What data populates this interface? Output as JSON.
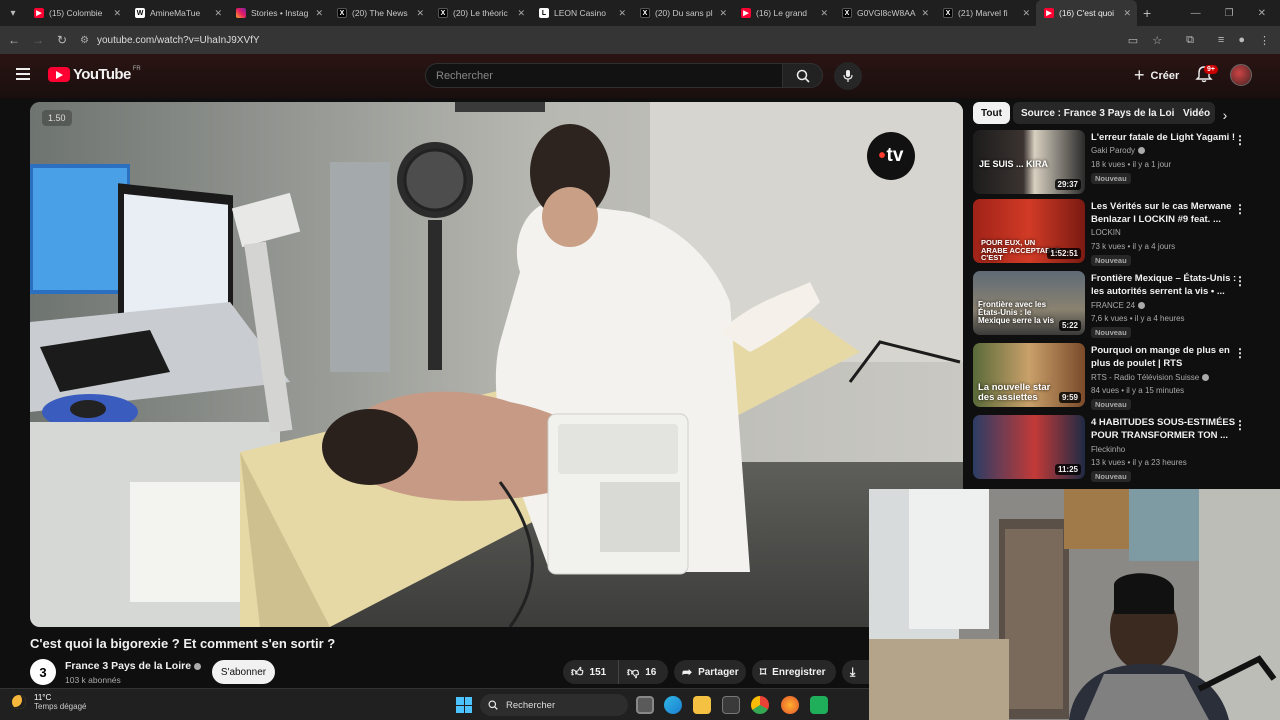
{
  "browser": {
    "tabs": [
      {
        "label": "(15) Colombie",
        "icon": "youtube-icon"
      },
      {
        "label": "AmineMaTue",
        "icon": "w-icon"
      },
      {
        "label": "Stories • Instag",
        "icon": "instagram-icon"
      },
      {
        "label": "(20) The News",
        "icon": "x-icon"
      },
      {
        "label": "(20) Le théoric",
        "icon": "x-icon"
      },
      {
        "label": "LEON Casino",
        "icon": "leon-icon"
      },
      {
        "label": "(20) Du sans pl",
        "icon": "x-icon"
      },
      {
        "label": "(16) Le grand",
        "icon": "youtube-icon"
      },
      {
        "label": "G0VGl8cW8AA",
        "icon": "x-icon"
      },
      {
        "label": "(21) Marvel fi",
        "icon": "x-icon"
      },
      {
        "label": "(16) C'est quoi",
        "icon": "youtube-icon",
        "active": true
      }
    ],
    "url": "youtube.com/watch?v=UhaInJ9XVfY"
  },
  "header": {
    "logo_text": "YouTube",
    "country": "FR",
    "search_placeholder": "Rechercher",
    "create_label": "Créer",
    "notif_count": "9+"
  },
  "video": {
    "speed_badge": "1.50",
    "channel_watermark": "tv",
    "title": "C'est quoi la bigorexie ? Et comment s'en sortir ?",
    "channel": "France 3 Pays de la Loire",
    "channel_avatar_text": "3",
    "subscribers": "103 k abonnés",
    "subscribe_label": "S'abonner",
    "likes": "151",
    "dislikes": "16",
    "share_label": "Partager",
    "save_label": "Enregistrer"
  },
  "sidebar": {
    "chips": [
      "Tout",
      "Source : France 3 Pays de la Loire",
      "Vidéo"
    ],
    "recommendations": [
      {
        "title": "L'erreur fatale de Light Yagami !",
        "channel": "Gaki Parody",
        "verified": true,
        "meta": "18 k vues • il y a 1 jour",
        "duration": "29:37",
        "badge": "Nouveau",
        "thumb_text": "JE SUIS ... KIRA"
      },
      {
        "title": "Les Vérités sur le cas Merwane Benlazar I LOCKIN #9 feat. ...",
        "channel": "LOCKIN",
        "verified": false,
        "meta": "73 k vues • il y a 4 jours",
        "duration": "1:52:51",
        "badge": "Nouveau",
        "thumb_text": "POUR EUX, UN ARABE ACCEPTABLE C'EST"
      },
      {
        "title": "Frontière Mexique – États-Unis : les autorités serrent la vis • ...",
        "channel": "FRANCE 24",
        "verified": true,
        "meta": "7,6 k vues • il y a 4 heures",
        "duration": "5:22",
        "badge": "Nouveau",
        "thumb_text": "Frontière avec les États-Unis : le Mexique serre la vis"
      },
      {
        "title": "Pourquoi on mange de plus en plus de poulet | RTS",
        "channel": "RTS - Radio Télévision Suisse",
        "verified": true,
        "meta": "84 vues • il y a 15 minutes",
        "duration": "9:59",
        "badge": "Nouveau",
        "thumb_text": "La nouvelle star des assiettes"
      },
      {
        "title": "4 HABITUDES SOUS-ESTIMÉES POUR TRANSFORMER TON ...",
        "channel": "Fleckinho",
        "verified": false,
        "meta": "13 k vues • il y a 23 heures",
        "duration": "11:25",
        "badge": "Nouveau",
        "thumb_text": ""
      }
    ]
  },
  "taskbar": {
    "temperature": "11°C",
    "weather": "Temps dégagé",
    "search_label": "Rechercher"
  }
}
